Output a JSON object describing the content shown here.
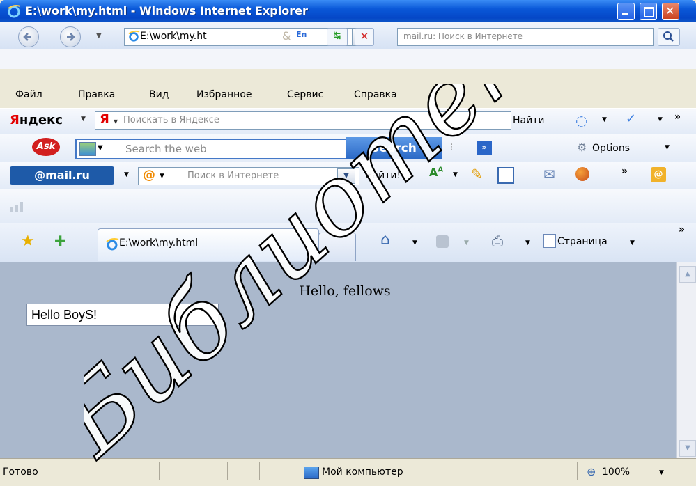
{
  "window": {
    "title": "E:\\work\\my.html - Windows Internet Explorer"
  },
  "address_bar": {
    "url": "E:\\work\\my.ht",
    "search_placeholder": "mail.ru: Поиск в Интернете"
  },
  "menu": {
    "items": [
      "Файл",
      "Правка",
      "Вид",
      "Избранное",
      "Сервис",
      "Справка"
    ]
  },
  "yandex_toolbar": {
    "brand": "Яндекс",
    "search_placeholder": "Поискать в Яндексе",
    "find_label": "Найти"
  },
  "ask_toolbar": {
    "search_placeholder": "Search the web",
    "search_button": "Search",
    "options_label": "Options"
  },
  "mail_toolbar": {
    "brand": "@mail.ru",
    "search_placeholder": "Поиск в Интернете",
    "find_label": "Найти!"
  },
  "tabs": {
    "active_tab_title": "E:\\work\\my.html",
    "page_menu_label": "Страница"
  },
  "page": {
    "heading": "Hello, fellows",
    "input_value": "Hello BoyS!"
  },
  "status": {
    "text": "Готово",
    "zone": "Мой компьютер",
    "zoom": "100%"
  },
  "watermark": {
    "text": "Библиотека БГУИР"
  },
  "colors": {
    "titlebar": "#0a58d8",
    "content_bg": "#aab8cc",
    "ask_button": "#2a68c5"
  }
}
